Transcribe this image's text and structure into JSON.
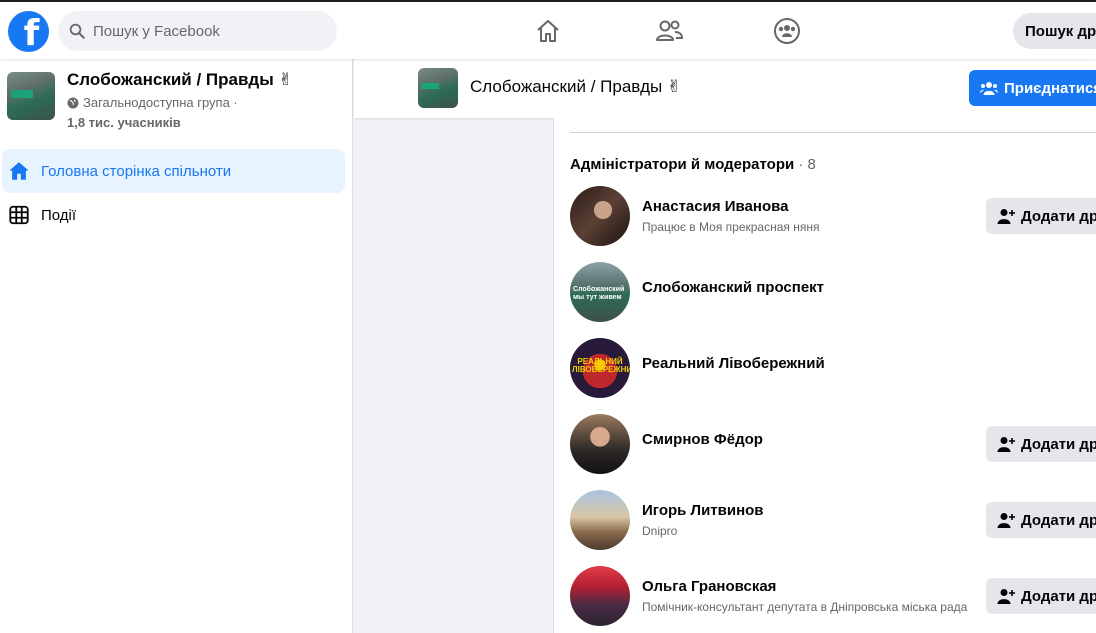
{
  "topbar": {
    "search_placeholder": "Пошук у Facebook",
    "right_button_label": "Пошук дру"
  },
  "group": {
    "name": "Слобожанский / Правды ✌",
    "privacy": "Загальнодоступна група ·",
    "members": "1,8 тис. учасників"
  },
  "sidebar": {
    "items": [
      {
        "label": "Головна сторінка спільноти"
      },
      {
        "label": "Події"
      }
    ]
  },
  "header": {
    "title": "Слобожанский / Правды ✌",
    "join_label": "Приєднатися"
  },
  "admins": {
    "title": "Адміністратори й модератори",
    "count": "· 8",
    "add_friend_label": "Додати дру",
    "members": [
      {
        "name": "Анастасия Иванова",
        "subtitle": "Працює в Моя прекрасная няня",
        "has_add": true
      },
      {
        "name": "Слобожанский проспект",
        "subtitle": "",
        "avatar_text": "Слобожанский мы тут живем",
        "has_add": false
      },
      {
        "name": "Реальний Лівобережний",
        "subtitle": "",
        "avatar_text": "РЕАЛЬНИЙ ЛІВОБЕРЕЖНИЙ",
        "has_add": false
      },
      {
        "name": "Смирнов Фёдор",
        "subtitle": "",
        "has_add": true
      },
      {
        "name": "Игорь Литвинов",
        "subtitle": "Dnipro",
        "has_add": true
      },
      {
        "name": "Ольга Грановская",
        "subtitle": "Помічник-консультант депутата в Дніпровська міська рада",
        "has_add": true
      }
    ]
  },
  "colors": {
    "brand": "#1877f2",
    "active_bg": "#e7f3ff",
    "secondary_text": "#65676b"
  }
}
